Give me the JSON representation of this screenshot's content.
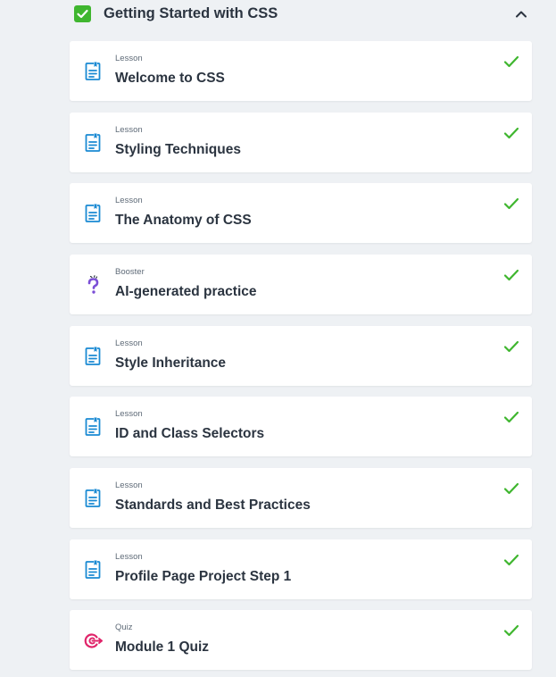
{
  "module": {
    "title": "Getting Started with CSS",
    "status": "completed",
    "expanded": true
  },
  "colors": {
    "complete_green": "#3fb62f",
    "lesson_blue": "#1a8ad3",
    "booster_purple": "#7b4fd6",
    "quiz_pink": "#e0246a"
  },
  "items": [
    {
      "type": "Lesson",
      "title": "Welcome to CSS",
      "icon": "lesson-document-icon",
      "completed": true
    },
    {
      "type": "Lesson",
      "title": "Styling Techniques",
      "icon": "lesson-document-icon",
      "completed": true
    },
    {
      "type": "Lesson",
      "title": "The Anatomy of CSS",
      "icon": "lesson-document-icon",
      "completed": true
    },
    {
      "type": "Booster",
      "title": "AI-generated practice",
      "icon": "booster-question-icon",
      "completed": true
    },
    {
      "type": "Lesson",
      "title": "Style Inheritance",
      "icon": "lesson-document-icon",
      "completed": true
    },
    {
      "type": "Lesson",
      "title": "ID and Class Selectors",
      "icon": "lesson-document-icon",
      "completed": true
    },
    {
      "type": "Lesson",
      "title": "Standards and Best Practices",
      "icon": "lesson-document-icon",
      "completed": true
    },
    {
      "type": "Lesson",
      "title": "Profile Page Project Step 1",
      "icon": "lesson-document-icon",
      "completed": true
    },
    {
      "type": "Quiz",
      "title": "Module 1 Quiz",
      "icon": "quiz-target-icon",
      "completed": true
    }
  ]
}
